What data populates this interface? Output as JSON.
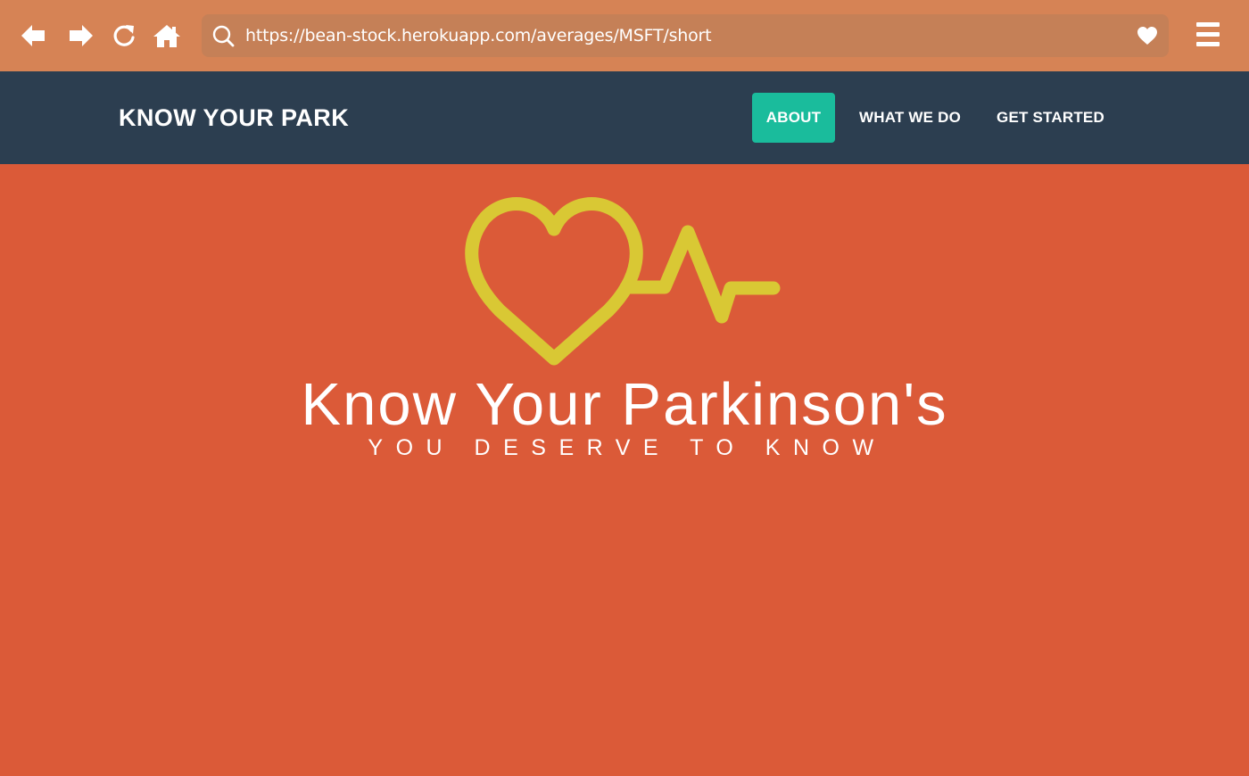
{
  "browser": {
    "url": "https://bean-stock.herokuapp.com/averages/MSFT/short",
    "icons": {
      "back": "back-arrow-icon",
      "forward": "forward-arrow-icon",
      "reload": "reload-icon",
      "home": "home-icon",
      "search": "search-icon",
      "bookmark": "heart-icon",
      "menu": "hamburger-menu-icon"
    },
    "colors": {
      "toolbar": "#D68355",
      "url_field": "#C58057"
    }
  },
  "site_nav": {
    "brand": "KNOW YOUR PARK",
    "links": [
      {
        "label": "ABOUT",
        "active": true
      },
      {
        "label": "WHAT WE DO",
        "active": false
      },
      {
        "label": "GET STARTED",
        "active": false
      }
    ],
    "colors": {
      "background": "#2C3E50",
      "active_link": "#1ABC9C"
    }
  },
  "hero": {
    "logo_icon": "heart-pulse-icon",
    "title": "Know Your Parkinson's",
    "tagline": "YOU DESERVE TO KNOW",
    "colors": {
      "background": "#DB5A38",
      "logo": "#D9C834",
      "text": "#FFFFFF"
    }
  }
}
